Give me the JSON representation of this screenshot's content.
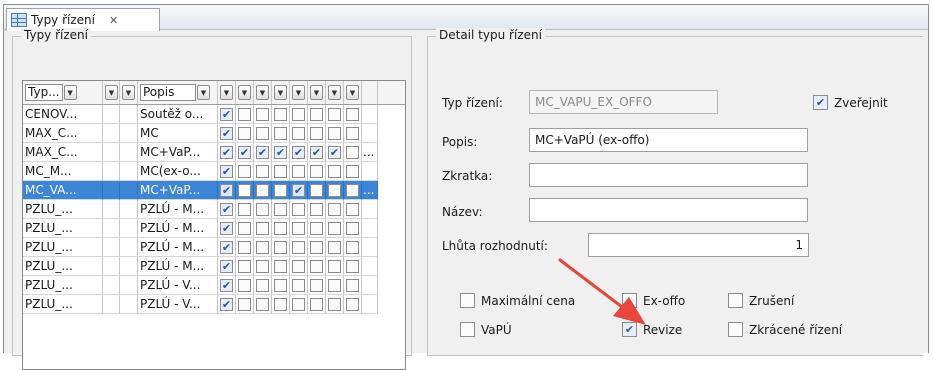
{
  "tab": {
    "label": "Typy řízení",
    "close": "✕"
  },
  "left_panel": {
    "title": "Typy řízení",
    "columns": {
      "typ": "Typ...",
      "popis": "Popis"
    },
    "rows": [
      {
        "typ": "CENOV...",
        "popis": "Soutěž o...",
        "checks": [
          1,
          0,
          0,
          0,
          0,
          0,
          0,
          0
        ],
        "last": "",
        "selected": false
      },
      {
        "typ": "MAX_C...",
        "popis": "MC",
        "checks": [
          1,
          0,
          0,
          0,
          0,
          0,
          0,
          0
        ],
        "last": "",
        "selected": false
      },
      {
        "typ": "MAX_C...",
        "popis": "MC+VaP...",
        "checks": [
          1,
          1,
          1,
          1,
          1,
          1,
          1,
          0
        ],
        "last": "...",
        "selected": false
      },
      {
        "typ": "MC_M...",
        "popis": "MC(ex-o...",
        "checks": [
          1,
          0,
          0,
          0,
          0,
          0,
          0,
          0
        ],
        "last": "",
        "selected": false
      },
      {
        "typ": "MC_VA...",
        "popis": "MC+VaP...",
        "checks": [
          1,
          0,
          0,
          0,
          1,
          0,
          0,
          0
        ],
        "last": "...",
        "selected": true
      },
      {
        "typ": "PZLU_...",
        "popis": "PZLÚ - M...",
        "checks": [
          1,
          0,
          0,
          0,
          0,
          0,
          0,
          0
        ],
        "last": "",
        "selected": false
      },
      {
        "typ": "PZLU_...",
        "popis": "PZLÚ - M...",
        "checks": [
          1,
          0,
          0,
          0,
          0,
          0,
          0,
          0
        ],
        "last": "",
        "selected": false
      },
      {
        "typ": "PZLU_...",
        "popis": "PZLÚ - M...",
        "checks": [
          1,
          0,
          0,
          0,
          0,
          0,
          0,
          0
        ],
        "last": "",
        "selected": false
      },
      {
        "typ": "PZLU_...",
        "popis": "PZLÚ - M...",
        "checks": [
          1,
          0,
          0,
          0,
          0,
          0,
          0,
          0
        ],
        "last": "",
        "selected": false
      },
      {
        "typ": "PZLU_...",
        "popis": "PZLÚ - V...",
        "checks": [
          1,
          0,
          0,
          0,
          0,
          0,
          0,
          0
        ],
        "last": "",
        "selected": false
      },
      {
        "typ": "PZLU_...",
        "popis": "PZLÚ - V...",
        "checks": [
          1,
          0,
          0,
          0,
          0,
          0,
          0,
          0
        ],
        "last": "",
        "selected": false
      }
    ]
  },
  "detail": {
    "title": "Detail typu řízení",
    "typ_label": "Typ řízení:",
    "typ_value": "MC_VAPU_EX_OFFO",
    "zverejnit_label": "Zveřejnit",
    "zverejnit_checked": true,
    "popis_label": "Popis:",
    "popis_value": "MC+VaPÚ (ex-offo)",
    "zkratka_label": "Zkratka:",
    "zkratka_value": "",
    "nazev_label": "Název:",
    "nazev_value": "",
    "lhuta_label": "Lhůta rozhodnutí:",
    "lhuta_value": "1",
    "options": {
      "max_cena": {
        "label": "Maximální cena",
        "checked": false
      },
      "ex_offo": {
        "label": "Ex-offo",
        "checked": false
      },
      "zruseni": {
        "label": "Zrušení",
        "checked": false
      },
      "vapu": {
        "label": "VaPÚ",
        "checked": false
      },
      "revize": {
        "label": "Revize",
        "checked": true
      },
      "zkracene": {
        "label": "Zkrácené řízení",
        "checked": false
      }
    }
  },
  "colors": {
    "selection": "#3d85d6",
    "arrow": "#e8453c",
    "check": "#2b5797"
  }
}
